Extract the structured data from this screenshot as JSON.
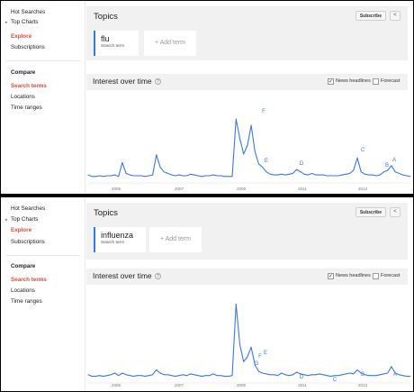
{
  "sidebar": {
    "items": [
      "Hot Searches",
      "Top Charts",
      "Explore",
      "Subscriptions"
    ],
    "compare_heading": "Compare",
    "compare_items": [
      "Search terms",
      "Locations",
      "Time ranges"
    ]
  },
  "panels": [
    {
      "topics_title": "Topics",
      "subscribe_label": "Subscribe",
      "share_icon": "share-icon",
      "term_name": "flu",
      "term_sub": "Search term",
      "add_term": "+ Add term",
      "interest_title": "Interest over time",
      "news_headlines_label": "News headlines",
      "news_headlines_checked": true,
      "forecast_label": "Forecast",
      "forecast_checked": false,
      "chart_data": {
        "type": "line",
        "x_ticks": [
          "2005",
          "2007",
          "2009",
          "2011",
          "2013"
        ],
        "annotations": [
          "F",
          "E",
          "D",
          "C",
          "B",
          "A"
        ],
        "color": "#3b78e7",
        "series": [
          {
            "values": [
              8,
              6,
              6,
              7,
              6,
              7,
              7,
              8,
              6,
              24,
              10,
              8,
              7,
              7,
              7,
              6,
              7,
              8,
              34,
              18,
              12,
              10,
              8,
              7,
              8,
              7,
              7,
              9,
              8,
              7,
              6,
              7,
              7,
              8,
              7,
              7,
              6,
              6,
              6,
              80,
              55,
              35,
              46,
              72,
              38,
              22,
              18,
              12,
              9,
              8,
              8,
              9,
              8,
              9,
              10,
              15,
              12,
              9,
              8,
              10,
              8,
              8,
              8,
              7,
              7,
              7,
              7,
              8,
              9,
              10,
              14,
              30,
              12,
              9,
              8,
              8,
              7,
              8,
              12,
              14,
              20,
              12,
              10,
              8,
              7,
              6
            ]
          }
        ]
      }
    },
    {
      "topics_title": "Topics",
      "subscribe_label": "Subscribe",
      "share_icon": "share-icon",
      "term_name": "influenza",
      "term_sub": "Search term",
      "add_term": "+ Add term",
      "interest_title": "Interest over time",
      "news_headlines_label": "News headlines",
      "news_headlines_checked": true,
      "forecast_label": "Forecast",
      "forecast_checked": false,
      "chart_data": {
        "type": "line",
        "x_ticks": [
          "2005",
          "2007",
          "2009",
          "2011",
          "2013"
        ],
        "annotations": [
          "G",
          "F",
          "E",
          "D",
          "C",
          "B",
          "A"
        ],
        "color": "#3b78e7",
        "series": [
          {
            "values": [
              8,
              6,
              6,
              7,
              6,
              7,
              8,
              10,
              7,
              10,
              8,
              7,
              6,
              7,
              7,
              6,
              7,
              8,
              14,
              10,
              8,
              8,
              7,
              6,
              7,
              8,
              7,
              9,
              8,
              7,
              6,
              7,
              7,
              9,
              7,
              7,
              6,
              6,
              7,
              95,
              45,
              24,
              30,
              42,
              20,
              12,
              10,
              9,
              8,
              8,
              7,
              10,
              8,
              7,
              8,
              11,
              9,
              8,
              7,
              8,
              8,
              9,
              8,
              7,
              6,
              7,
              7,
              8,
              9,
              10,
              9,
              14,
              10,
              8,
              7,
              7,
              7,
              8,
              9,
              10,
              18,
              10,
              8,
              7,
              6,
              6
            ]
          }
        ]
      }
    }
  ]
}
